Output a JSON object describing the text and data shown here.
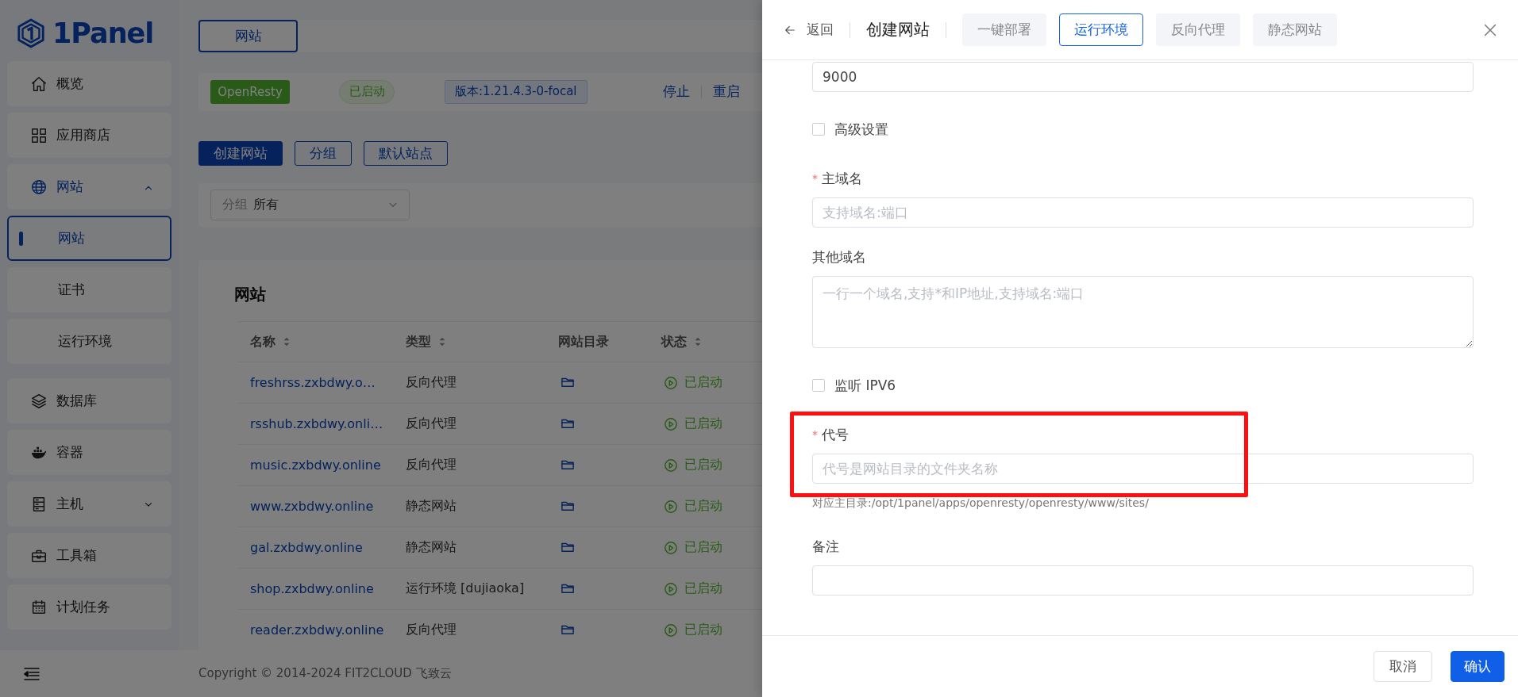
{
  "sidebar": {
    "logo": "1Panel",
    "items": [
      {
        "label": "概览",
        "selected": false
      },
      {
        "label": "应用商店",
        "selected": false
      },
      {
        "label": "网站",
        "selected": true,
        "expanded": true,
        "children": [
          {
            "label": "网站",
            "selected": true
          },
          {
            "label": "证书",
            "selected": false
          },
          {
            "label": "运行环境",
            "selected": false
          }
        ]
      },
      {
        "label": "数据库",
        "selected": false
      },
      {
        "label": "容器",
        "selected": false
      },
      {
        "label": "主机",
        "selected": false,
        "expanded": false
      },
      {
        "label": "工具箱",
        "selected": false
      },
      {
        "label": "计划任务",
        "selected": false
      }
    ]
  },
  "main": {
    "tabs": [
      {
        "label": "网站",
        "selected": true
      }
    ],
    "app_status": {
      "name": "OpenResty",
      "status": "已启动",
      "version": "版本:1.21.4.3-0-focal",
      "actions": [
        "停止",
        "重启"
      ]
    },
    "toolbar": [
      {
        "label": "创建网站",
        "primary": true
      },
      {
        "label": "分组",
        "primary": false
      },
      {
        "label": "默认站点",
        "primary": false
      }
    ],
    "filter": {
      "label": "分组",
      "value": "所有"
    },
    "table": {
      "title": "网站",
      "columns": [
        {
          "label": "名称",
          "sortable": true
        },
        {
          "label": "类型",
          "sortable": true
        },
        {
          "label": "网站目录",
          "sortable": false
        },
        {
          "label": "状态",
          "sortable": true
        }
      ],
      "rows": [
        {
          "name": "freshrss.zxbdwy.o…",
          "type": "反向代理",
          "status": "已启动"
        },
        {
          "name": "rsshub.zxbdwy.onli…",
          "type": "反向代理",
          "status": "已启动"
        },
        {
          "name": "music.zxbdwy.online",
          "type": "反向代理",
          "status": "已启动"
        },
        {
          "name": "www.zxbdwy.online",
          "type": "静态网站",
          "status": "已启动"
        },
        {
          "name": "gal.zxbdwy.online",
          "type": "静态网站",
          "status": "已启动"
        },
        {
          "name": "shop.zxbdwy.online",
          "type": "运行环境 [dujiaoka]",
          "status": "已启动"
        },
        {
          "name": "reader.zxbdwy.online",
          "type": "反向代理",
          "status": "已启动"
        }
      ]
    },
    "copyright": "Copyright © 2014-2024 FIT2CLOUD 飞致云"
  },
  "drawer": {
    "back": "返回",
    "title": "创建网站",
    "tabs": [
      {
        "label": "一键部署",
        "selected": false
      },
      {
        "label": "运行环境",
        "selected": true
      },
      {
        "label": "反向代理",
        "selected": false
      },
      {
        "label": "静态网站",
        "selected": false
      }
    ],
    "fields": [
      {
        "kind": "input",
        "value": "9000"
      },
      {
        "kind": "checkbox",
        "label": "高级设置",
        "checked": false
      },
      {
        "kind": "input",
        "label": "主域名",
        "required_mark": "*",
        "placeholder": "支持域名:端口"
      },
      {
        "kind": "textarea",
        "label": "其他域名",
        "placeholder": "一行一个域名,支持*和IP地址,支持域名:端口"
      },
      {
        "kind": "checkbox",
        "label": "监听 IPV6",
        "checked": false
      },
      {
        "kind": "input",
        "label": "代号",
        "required_mark": "*",
        "placeholder": "代号是网站目录的文件夹名称",
        "hint": "对应主目录:/opt/1panel/apps/openresty/openresty/www/sites/",
        "highlighted": true
      },
      {
        "kind": "input",
        "label": "备注"
      }
    ],
    "buttons": [
      {
        "label": "取消",
        "primary": false
      },
      {
        "label": "确认",
        "primary": true
      }
    ]
  }
}
